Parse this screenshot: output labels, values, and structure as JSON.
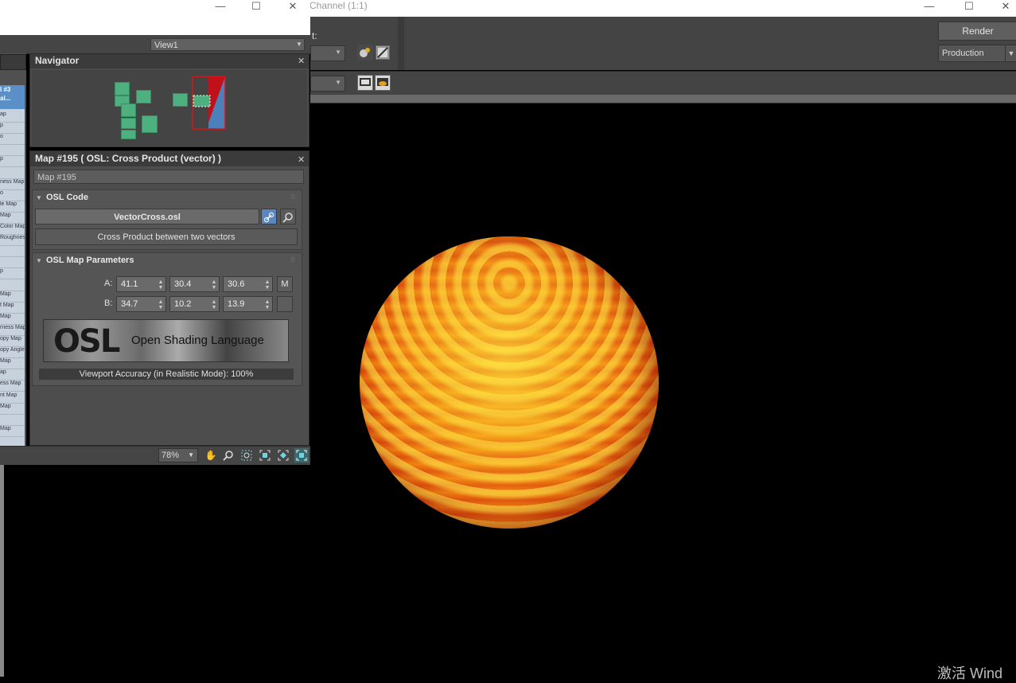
{
  "render_window": {
    "title": "Channel (1:1)",
    "toolbar_label": "t:",
    "render_button": "Render",
    "production_select": "Production",
    "watermark": "激活 Wind"
  },
  "slate": {
    "view_select": "View1",
    "left_list": {
      "selected": [
        "l #3",
        "al..."
      ],
      "items": [
        "ap",
        "p",
        "o",
        "",
        "p",
        "",
        "ness Map",
        "o",
        "le Map",
        "Map",
        "Color Map",
        "Roughness",
        "",
        "",
        "p",
        "",
        "Map",
        "t Map",
        "Map",
        "rness Map",
        "opy Map",
        "opy Angle",
        "Map",
        "ap",
        "ess Map",
        "nt Map",
        "Map",
        "",
        "Map"
      ]
    },
    "navigator": {
      "title": "Navigator"
    },
    "map_panel": {
      "title": "Map #195  ( OSL: Cross Product (vector) )",
      "name": "Map #195",
      "osl_code": {
        "title": "OSL Code",
        "file": "VectorCross.osl",
        "description": "Cross Product between two vectors"
      },
      "params": {
        "title": "OSL Map Parameters",
        "a_label": "A:",
        "a_values": [
          "41.1",
          "30.4",
          "30.6"
        ],
        "a_button": "M",
        "b_label": "B:",
        "b_values": [
          "34.7",
          "10.2",
          "13.9"
        ],
        "logo_text": "Open Shading Language",
        "logo_mark": "OSL",
        "accuracy": "Viewport Accuracy (in Realistic Mode): 100%"
      }
    },
    "status": {
      "zoom": "78%"
    }
  },
  "icons": [
    "minimize-icon",
    "maximize-icon",
    "close-icon",
    "render-setup-icon",
    "environment-icon",
    "display-icon",
    "render-teapot-icon",
    "link-icon",
    "search-icon",
    "pan-hand-icon",
    "zoom-icon",
    "zoom-region-icon",
    "zoom-extents-icon",
    "zoom-selected-icon",
    "frame-all-icon"
  ],
  "colors": {
    "node": "#4fb07f",
    "panel": "#4d4d4d",
    "link_active": "#5b86c0"
  }
}
